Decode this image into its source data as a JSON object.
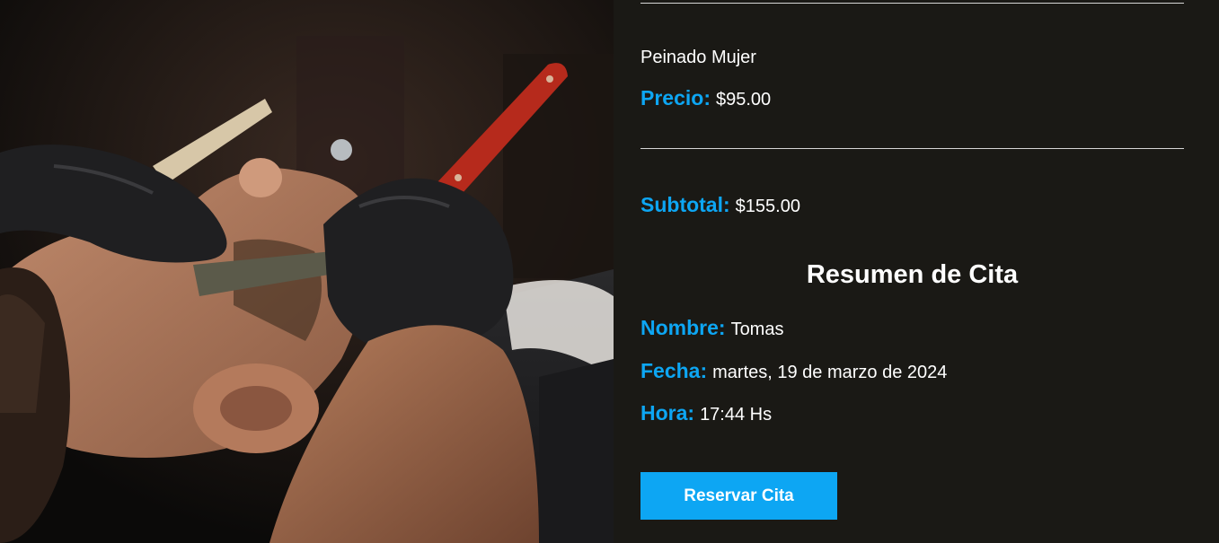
{
  "hero": {
    "image_icon": "barber-shave-photo"
  },
  "service": {
    "name": "Peinado Mujer",
    "price_label": "Precio:",
    "price_value": "$95.00"
  },
  "subtotal": {
    "label": "Subtotal:",
    "value": "$155.00"
  },
  "summary": {
    "title": "Resumen de Cita",
    "name_label": "Nombre:",
    "name_value": "Tomas",
    "date_label": "Fecha:",
    "date_value": "martes, 19 de marzo de 2024",
    "time_label": "Hora:",
    "time_value": "17:44 Hs"
  },
  "actions": {
    "reserve_label": "Reservar Cita"
  },
  "colors": {
    "accent": "#0da6f3",
    "background": "#1a1915",
    "text": "#ffffff"
  }
}
